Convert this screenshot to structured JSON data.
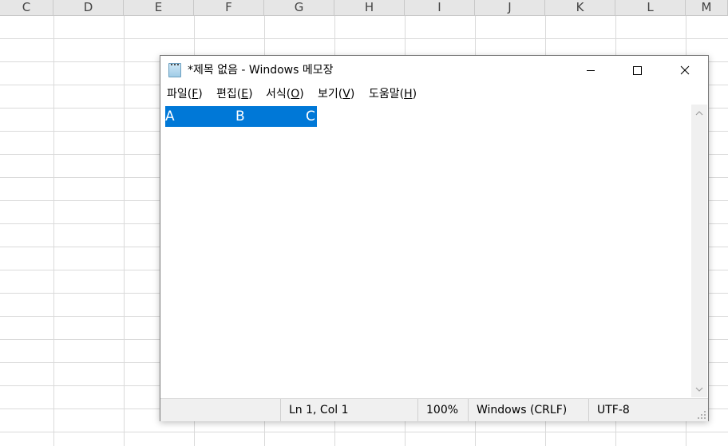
{
  "spreadsheet": {
    "columns": [
      "C",
      "D",
      "E",
      "F",
      "G",
      "H",
      "I",
      "J",
      "K",
      "L",
      "M"
    ]
  },
  "notepad": {
    "title": "*제목 없음 - Windows 메모장",
    "menu": [
      {
        "label": "파일(",
        "key": "F",
        "suffix": ")"
      },
      {
        "label": "편집(",
        "key": "E",
        "suffix": ")"
      },
      {
        "label": "서식(",
        "key": "O",
        "suffix": ")"
      },
      {
        "label": "보기(",
        "key": "V",
        "suffix": ")"
      },
      {
        "label": "도움말(",
        "key": "H",
        "suffix": ")"
      }
    ],
    "content": {
      "selected_text": [
        "A",
        "B",
        "C"
      ]
    },
    "status": {
      "position": "Ln 1, Col 1",
      "zoom": "100%",
      "line_ending": "Windows (CRLF)",
      "encoding": "UTF-8"
    },
    "colors": {
      "selection": "#0078d7",
      "statusbar": "#f0f0f0"
    },
    "icons": {
      "app": "notepad-icon",
      "minimize": "minimize-icon",
      "maximize": "maximize-icon",
      "close": "close-icon"
    }
  }
}
